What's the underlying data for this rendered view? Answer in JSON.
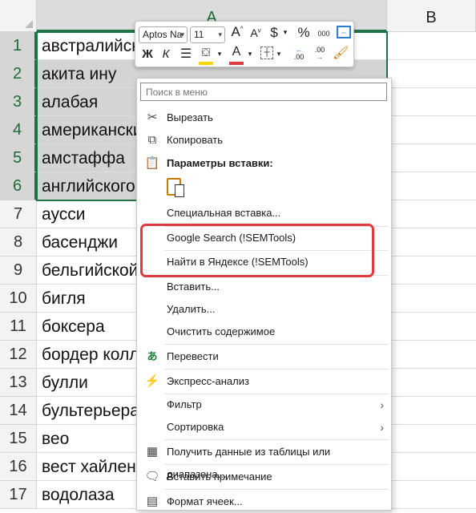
{
  "sheet": {
    "columns": [
      "A",
      "B"
    ],
    "rows": [
      {
        "num": "1",
        "a": "австралийских"
      },
      {
        "num": "2",
        "a": "акита ину"
      },
      {
        "num": "3",
        "a": "алабая"
      },
      {
        "num": "4",
        "a": "американских"
      },
      {
        "num": "5",
        "a": "амстаффа"
      },
      {
        "num": "6",
        "a": "английского"
      },
      {
        "num": "7",
        "a": "аусси"
      },
      {
        "num": "8",
        "a": "басенджи"
      },
      {
        "num": "9",
        "a": "бельгийской"
      },
      {
        "num": "10",
        "a": "бигля"
      },
      {
        "num": "11",
        "a": "боксера"
      },
      {
        "num": "12",
        "a": "бордер колли"
      },
      {
        "num": "13",
        "a": "булли"
      },
      {
        "num": "14",
        "a": "бультерьера"
      },
      {
        "num": "15",
        "a": "вео"
      },
      {
        "num": "16",
        "a": "вест хайленд"
      },
      {
        "num": "17",
        "a": "водолаза"
      }
    ]
  },
  "mini_toolbar": {
    "font_name": "Aptos Na",
    "font_size": "11",
    "grow_font": "A",
    "shrink_font": "A",
    "currency": "$",
    "percent": "%",
    "thousands": "000",
    "bold": "Ж",
    "italic": "К",
    "font_color_letter": "A",
    "decrease_decimal": ".00",
    "increase_decimal": ".00"
  },
  "colors": {
    "selection_border": "#1e7145",
    "font_color_bar": "#e0393e",
    "fill_color_bar": "#ffd500",
    "highlight": "#e0393e"
  },
  "context_menu": {
    "search_placeholder": "Поиск в меню",
    "items": [
      {
        "label": "Вырезать",
        "icon": "scissors-icon"
      },
      {
        "label": "Копировать",
        "icon": "copy-icon"
      },
      {
        "label": "Параметры вставки:",
        "icon": "paste-options-icon"
      },
      {
        "label": "Специальная вставка...",
        "icon": ""
      },
      {
        "label": "Google Search (!SEMTools)",
        "icon": ""
      },
      {
        "label": "Найти в Яндексе (!SEMTools)",
        "icon": ""
      },
      {
        "label": "Вставить...",
        "icon": ""
      },
      {
        "label": "Удалить...",
        "icon": ""
      },
      {
        "label": "Очистить содержимое",
        "icon": ""
      },
      {
        "label": "Перевести",
        "icon": "translate-icon"
      },
      {
        "label": "Экспресс-анализ",
        "icon": "quick-analysis-icon"
      },
      {
        "label": "Фильтр",
        "icon": ""
      },
      {
        "label": "Сортировка",
        "icon": ""
      },
      {
        "label": "Получить данные из таблицы или диапазона...",
        "icon": "table-icon"
      },
      {
        "label": "Вставить примечание",
        "icon": "comment-icon"
      },
      {
        "label": "Формат ячеек...",
        "icon": "format-cells-icon"
      }
    ]
  }
}
